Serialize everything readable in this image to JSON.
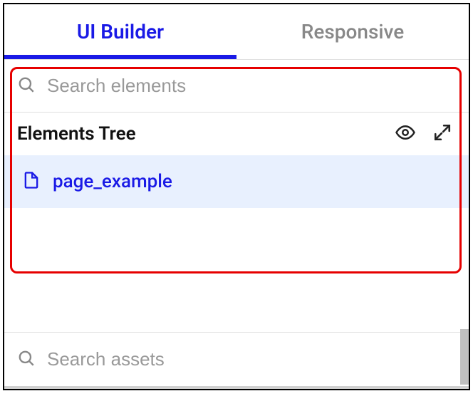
{
  "tabs": {
    "builder": "UI Builder",
    "responsive": "Responsive"
  },
  "search_elements": {
    "placeholder": "Search elements"
  },
  "elements_tree": {
    "title": "Elements Tree",
    "items": [
      {
        "label": "page_example"
      }
    ]
  },
  "search_assets": {
    "placeholder": "Search assets"
  }
}
